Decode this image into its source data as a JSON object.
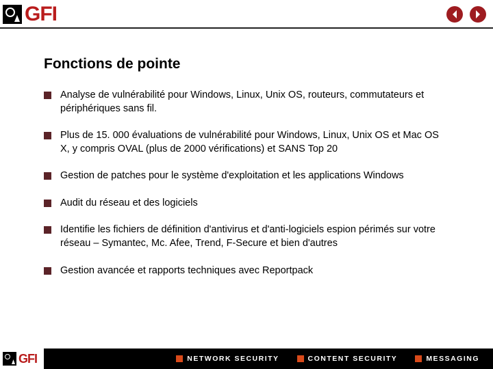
{
  "logo": {
    "text": "GFI"
  },
  "title": "Fonctions de pointe",
  "bullets": [
    "Analyse de vulnérabilité pour Windows, Linux, Unix OS, routeurs, commutateurs et périphériques sans fil.",
    "Plus de 15. 000 évaluations de vulnérabilité pour Windows, Linux, Unix OS et Mac OS X, y compris OVAL (plus de 2000 vérifications) et SANS Top 20",
    "Gestion de patches pour le système d'exploitation et les applications Windows",
    "Audit du réseau et des logiciels",
    "Identifie les fichiers de définition d'antivirus et d'anti-logiciels espion périmés sur votre réseau – Symantec, Mc. Afee, Trend, F-Secure et bien d'autres",
    "Gestion avancée et rapports techniques avec Reportpack"
  ],
  "footer": {
    "items": [
      "NETWORK SECURITY",
      "CONTENT SECURITY",
      "MESSAGING"
    ]
  }
}
